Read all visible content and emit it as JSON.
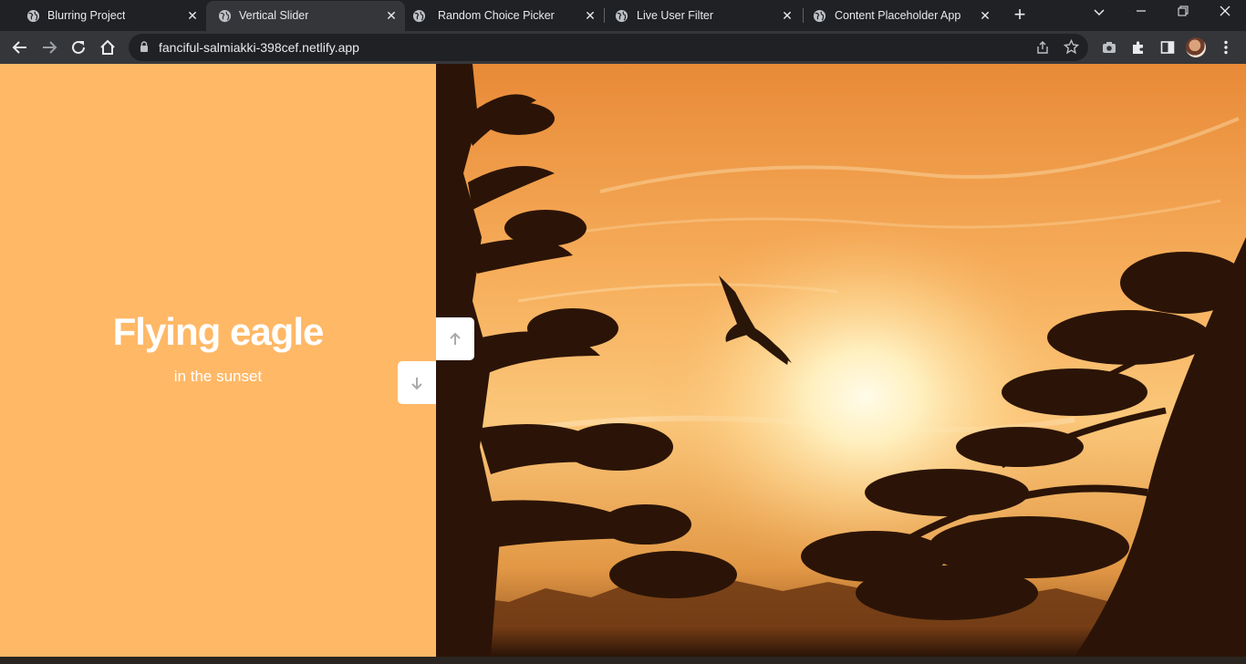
{
  "browser": {
    "tabs": [
      {
        "title": "Blurring Project",
        "active": false
      },
      {
        "title": "Vertical Slider",
        "active": true
      },
      {
        "title": "Random Choice Picker",
        "active": false
      },
      {
        "title": "Live User Filter",
        "active": false
      },
      {
        "title": "Content Placeholder App",
        "active": false
      }
    ],
    "url": "fanciful-salmiakki-398cef.netlify.app",
    "icons": [
      "back-icon",
      "forward-icon",
      "reload-icon",
      "home-icon",
      "lock-icon",
      "share-icon",
      "star-icon",
      "camera-icon",
      "extensions-icon",
      "side-panel-icon",
      "profile-avatar",
      "menu-icon"
    ]
  },
  "slide": {
    "title": "Flying eagle",
    "subtitle": "in the sunset",
    "background_color": "#ffb866",
    "image_alt": "eagle silhouette flying over pine trees at sunset"
  },
  "controls": {
    "up_icon": "arrow-up-icon",
    "down_icon": "arrow-down-icon"
  }
}
